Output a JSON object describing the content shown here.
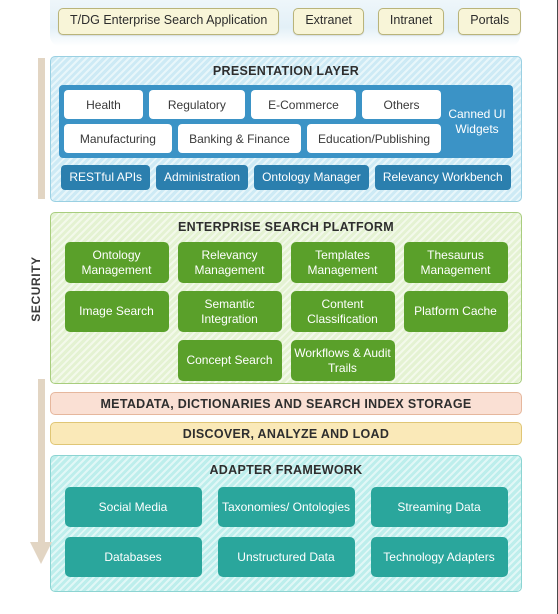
{
  "top_row": {
    "buttons": [
      "T/DG Enterprise Search Application",
      "Extranet",
      "Intranet",
      "Portals"
    ]
  },
  "security_rail": {
    "label": "SECURITY",
    "arrow_direction": "down",
    "arrow_color": "#e2d5c3"
  },
  "presentation_layer": {
    "title": "PRESENTATION LAYER",
    "panel_color": "#3b93c6",
    "row1": [
      "Health",
      "Regulatory",
      "E-Commerce",
      "Others"
    ],
    "row2": [
      "Manufacturing",
      "Banking & Finance",
      "Education/Publishing"
    ],
    "canned_widgets": "Canned UI Widgets",
    "api_row": [
      "RESTful APIs",
      "Administration",
      "Ontology Manager",
      "Relevancy Workbench"
    ]
  },
  "enterprise_search_platform": {
    "title": "ENTERPRISE SEARCH PLATFORM",
    "tile_color": "#5aa02a",
    "row1": [
      "Ontology Management",
      "Relevancy Management",
      "Templates Management",
      "Thesaurus Management"
    ],
    "row2": [
      "Image Search",
      "Semantic Integration",
      "Content Classification",
      "Platform Cache"
    ],
    "row3": [
      "Concept Search",
      "Workflows & Audit Trails"
    ]
  },
  "storage_bars": {
    "metadata": "METADATA, DICTIONARIES AND SEARCH INDEX STORAGE",
    "metadata_color": "#fae0d4",
    "discover": "DISCOVER, ANALYZE AND LOAD",
    "discover_color": "#fae9b8"
  },
  "adapter_framework": {
    "title": "ADAPTER FRAMEWORK",
    "tile_color": "#2aa69c",
    "row1": [
      "Social Media",
      "Taxonomies/ Ontologies",
      "Streaming Data"
    ],
    "row2": [
      "Databases",
      "Unstructured Data",
      "Technology Adapters"
    ]
  }
}
